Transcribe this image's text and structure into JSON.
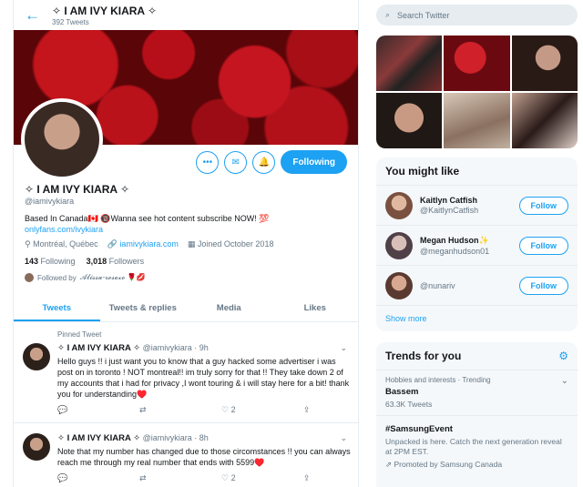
{
  "profile": {
    "name": "✧ I AM IVY KIARA ✧",
    "tweet_count": "392 Tweets",
    "handle": "@iamivykiara",
    "bio": "Based In Canada🇨🇦 🔞Wanna see hot content subscribe NOW! 💯",
    "bio_link": "onlyfans.com/ivykiara",
    "location": "Montréal, Québec",
    "website": "iamivykiara.com",
    "joined": "Joined October 2018",
    "following_count": "143",
    "following_label": "Following",
    "followers_count": "3,018",
    "followers_label": "Followers",
    "followed_by_prefix": "Followed by",
    "followed_by_name": "𝓐𝓵𝓲𝓼𝓼𝓪-𝓻𝓸𝓼𝓮𝔁𝓸 🌹💋",
    "follow_state": "Following"
  },
  "tabs": [
    "Tweets",
    "Tweets & replies",
    "Media",
    "Likes"
  ],
  "tweets": [
    {
      "pinned": "Pinned Tweet",
      "name": "✧ I AM IVY KIARA ✧",
      "handle": "@iamivykiara · 9h",
      "text": "Hello guys !! i just want you to know that a guy hacked some advertiser i was post on in toronto ! NOT montreal!! im truly sorry for that !! They take down 2 of my accounts that i had for privacy ,I wont touring & i will stay here for a bit! thank you for understanding♥️",
      "likes": "2"
    },
    {
      "name": "✧ I AM IVY KIARA ✧",
      "handle": "@iamivykiara · 8h",
      "text": "Note that my number has changed due to those circomstances !! you can always reach me through my real number that ends with 5599♥️",
      "likes": "2"
    }
  ],
  "search": {
    "placeholder": "Search Twitter"
  },
  "who_to_follow": {
    "title": "You might like",
    "users": [
      {
        "name": "Kaitlyn Catfish",
        "handle": "@KaitlynCatfish",
        "button": "Follow"
      },
      {
        "name": "Megan Hudson✨",
        "handle": "@meganhudson01",
        "button": "Follow"
      },
      {
        "name": "",
        "handle": "@nunariv",
        "button": "Follow"
      }
    ],
    "show_more": "Show more"
  },
  "trends": {
    "title": "Trends for you",
    "items": [
      {
        "context": "Hobbies and interests · Trending",
        "name": "Bassem",
        "count": "63.3K Tweets"
      },
      {
        "name": "#SamsungEvent",
        "desc": "Unpacked is here. Catch the next generation reveal at 2PM EST.",
        "promo": "Promoted by Samsung Canada"
      }
    ]
  },
  "colors": {
    "accent": "#1da1f2",
    "text": "#14171a",
    "muted": "#657786",
    "heart": "#c8102e"
  }
}
